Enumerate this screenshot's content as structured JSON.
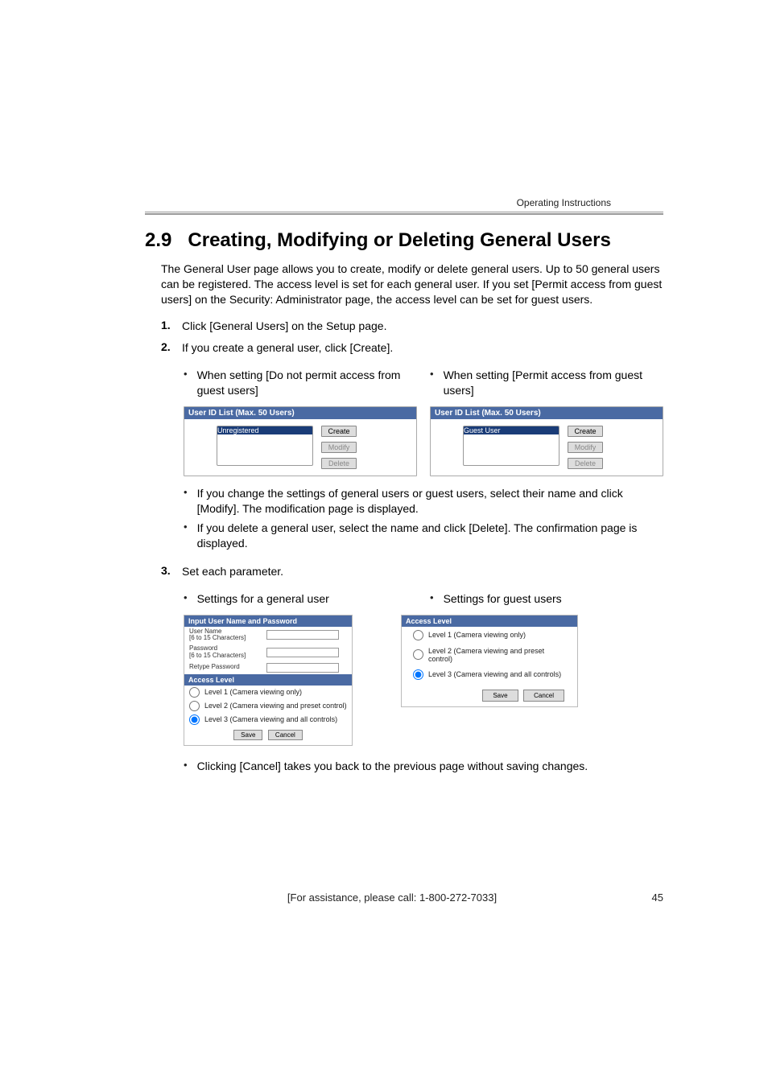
{
  "header": {
    "product_label": "Operating Instructions"
  },
  "section": {
    "number": "2.9",
    "title": "Creating, Modifying or Deleting General Users",
    "intro": "The General User page allows you to create, modify or delete general users. Up to 50 general users can be registered. The access level is set for each general user. If you set [Permit access from guest users] on the Security: Administrator page, the access level can be set for guest users."
  },
  "steps": {
    "s1": {
      "num": "1.",
      "text": "Click [General Users] on the Setup page."
    },
    "s2": {
      "num": "2.",
      "text": "If you create a general user, click [Create]."
    },
    "s3": {
      "num": "3.",
      "text": "Set each parameter."
    }
  },
  "twocol_top": {
    "left": "When setting [Do not permit access from guest users]",
    "right": "When setting [Permit access from guest users]"
  },
  "userlist": {
    "titlebar": "User ID List (Max. 50 Users)",
    "left_item": "Unregistered",
    "right_item": "Guest User",
    "buttons": {
      "create": "Create",
      "modify": "Modify",
      "delete": "Delete"
    }
  },
  "sub_bullets": {
    "b1": "If you change the settings of general users or guest users, select their name and click [Modify]. The modification page is displayed.",
    "b2": "If you delete a general user, select the name and click [Delete]. The confirmation page is displayed."
  },
  "settings_labels": {
    "general": "Settings for a general user",
    "guest": "Settings for guest users"
  },
  "general_panel": {
    "hdr": "Input User Name and Password",
    "username": "User Name\n[6 to 15 Characters]",
    "password": "Password\n[6 to 15 Characters]",
    "retype": "Retype Password",
    "access_hdr": "Access Level",
    "lvl1": "Level 1 (Camera viewing only)",
    "lvl2": "Level 2 (Camera viewing and preset control)",
    "lvl3": "Level 3 (Camera viewing and all controls)",
    "save": "Save",
    "cancel": "Cancel"
  },
  "guest_panel": {
    "hdr": "Access Level",
    "lvl1": "Level 1 (Camera viewing only)",
    "lvl2": "Level 2 (Camera viewing and preset control)",
    "lvl3": "Level 3 (Camera viewing and all controls)",
    "save": "Save",
    "cancel": "Cancel"
  },
  "cancel_note": "Clicking [Cancel] takes you back to the previous page without saving changes.",
  "footer": {
    "assist": "[For assistance, please call: 1-800-272-7033]",
    "page": "45"
  },
  "bullet": "•"
}
